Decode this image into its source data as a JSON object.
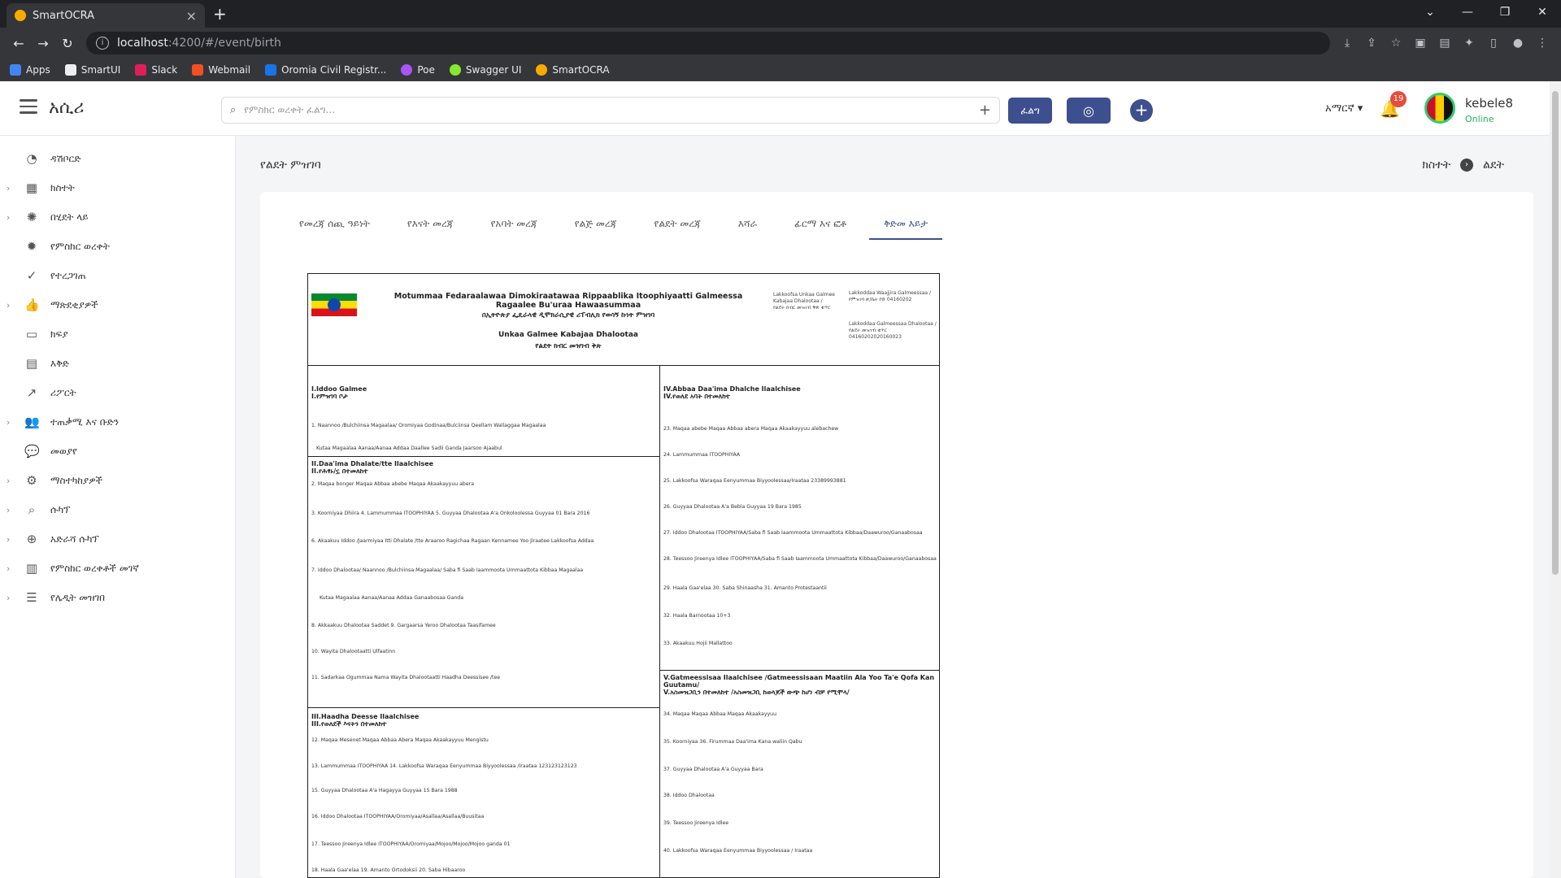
{
  "browser": {
    "tab_title": "SmartOCRA",
    "url_host": "localhost",
    "url_path": ":4200/#/event/birth",
    "bookmarks": [
      "Apps",
      "SmartUI",
      "Slack",
      "Webmail",
      "Oromia Civil Registr...",
      "Poe",
      "Swagger UI",
      "SmartOCRA"
    ]
  },
  "header": {
    "brand": "አሲሪ",
    "search_placeholder": "የምስክር ወረቀት ፈልግ...",
    "search_button": "ፈልግ",
    "language": "አማርኛ",
    "notification_count": "19",
    "user_name": "kebele8",
    "user_status": "Online"
  },
  "sidebar": {
    "items": [
      {
        "label": "ዳሽቦርድ",
        "icon": "dashboard-icon"
      },
      {
        "label": "ክስተት",
        "icon": "calendar-icon"
      },
      {
        "label": "በሂደት ላይ",
        "icon": "spinner-icon"
      },
      {
        "label": "የምስክር ወረቀት",
        "icon": "certificate-icon"
      },
      {
        "label": "የተረጋገጠ",
        "icon": "check-circle-icon"
      },
      {
        "label": "ማጽደቂያዎች",
        "icon": "thumbs-up-icon"
      },
      {
        "label": "ክፍያ",
        "icon": "credit-card-icon"
      },
      {
        "label": "እቅድ",
        "icon": "planner-icon"
      },
      {
        "label": "ሪፖርት",
        "icon": "chart-line-icon"
      },
      {
        "label": "ተጠቃሚ እና ቡድን",
        "icon": "users-icon"
      },
      {
        "label": "መወያየ",
        "icon": "chat-icon"
      },
      {
        "label": "ማስተካከያዎች",
        "icon": "gear-icon"
      },
      {
        "label": "ሱካፕ",
        "icon": "zoom-icon"
      },
      {
        "label": "አድራሻ ሱካፕ",
        "icon": "zoom-plus-icon"
      },
      {
        "label": "የምስክር ወረቀቶች መገኛ",
        "icon": "archive-icon"
      },
      {
        "label": "የሌዲት መዝገበ",
        "icon": "list-icon"
      }
    ]
  },
  "page": {
    "title": "የልደት ምዝገባ",
    "breadcrumb_1": "ክስተት",
    "breadcrumb_2": "ልደት",
    "tabs": [
      "የመረጃ ሰጪ ዓይነት",
      "የእናት መረጃ",
      "የአባት መረጃ",
      "የልጅ መረጃ",
      "የልደት መረጃ",
      "እሻራ",
      "ፊርማ እና ፎቶ",
      "ቅድመ እይታ"
    ]
  },
  "document": {
    "title_om": "Motummaa Fedaraalawaa Dimokiraatawaa Rippaablika Itoophiyaatti Galmeessa Ragaalee Bu'uraa Hawaasummaa",
    "title_am": "በኢትዮጵያ ፌዴራላዊ ዲሞክራሲያዊ ሪፐብሊክ የወሳኝ ኩነት ምዝገባ",
    "subtitle_om": "Unkaa Galmee Kabajaa Dhalootaa",
    "subtitle_am": "የልደት ክብር መዝገብ ቅጽ",
    "reg_left": "Lakkoofsa Unkaa Galmee Kabajaa Dhalootaa / የልደት ክብር መዝገብ ቅጽ ቁጥር",
    "reg_right_1": "Lakkoddaa Waajjira Galmeessaa / የምዝገባ ጽ/ቤት ኮድ 04160202",
    "reg_right_2": "Lakkoddaa Galmeessaa Dhalootaa / የልደት መዝገብ ቁጥር 04160202020160023",
    "sec1": "I.Iddoo Galmee\nI.የምዝገባ ቦታ",
    "sec1_l1": "1. Naannoo /Bulchiinsa Magaalaa/   Oromiyaa        Godinaa/Bulciinsa  Qeellam Wallaggaa        Magaalaa",
    "sec1_l2": "Kutaa Magaalaa              Aanaa/Aanaa Addaa   Daallee Sadii          Ganda  Jaarsoo Ajaabul",
    "sec2": "II.Daa'ima Dhalate/tte Ilaalchisee\nII.የሕፃኑ/ኗ በተመለከተ",
    "sec2_l1": "2. Maqaa  bonger             Maqaa Abbaa  abebe               Maqaa Akaakayyuu  abera",
    "sec2_l2": "3. Koorniyaa  Dhiira    4. Lammummaa  ITOOPHIYAA    5. Guyyaa Dhalootaa A'a Onkoloolessa Guyyaa 01   Bara 2016",
    "sec2_l3": "6. Akaakuu Iddoo /Jaarmiyaa Itti Dhalate /tte  Araaroo Ragichaa     Ragaan Kennamee Yoo Jiraatee Lakkoofsa Addaa",
    "sec2_l4": "7. Iddoo Dhalootaa/  Naannoo /Bulchiinsa Magaalaa/  Saba fi Saab Iaammoota Ummaattota Kibbaa     Magaalaa",
    "sec2_l5": "Kutaa Magaalaa            Aanaa/Aanaa Addaa  Ganaabosaa               Ganda",
    "sec2_l6": "8. Akkaakuu Dhalootaa  Saddet    9. Gargaarsa Yeroo Dhalootaa  Taasifamee",
    "sec2_l7": "10. Wayita Dhalootaatti Ulfaatinn",
    "sec2_l8": "11. Sadarkaa Ogummaa Nama Wayita Dhalootaatti Haadha Deessisee /tee",
    "sec3": "III.Haadha Deesse Ilaalchisee\nIII.የወለደች እናትን በተመለከተ",
    "sec3_l1": "12. Maqaa  Mesenet             Maqaa Abbaa  Abera                Maqaa Akaakayyuu  Mengistu",
    "sec3_l2": "13. Lammummaa  ITOOPHIYAA     14. Lakkoofsa Waraqaa Eenyummaa Biyyoolessaa /Iraataa  123123123123",
    "sec3_l3": "15. Guyyaa Dhalootaa A'a  Hagayya    Guyyaa  15      Bara  1988",
    "sec3_l4": "16. Iddoo Dhalootaa  ITOOPHIYAA/Oromiyaa/Asallaa/Asallaa/Buusitaa",
    "sec3_l5": "17. Teessoo Jireenya Idlee  ITOOPHIYAA/Oromiyaa/Mojoo/Mojoo/Mojoo ganda 01",
    "sec3_l6": "18. Haala Gaa'elaa            19. Amanto  Ortodoksii       20. Saba  Hibaaroo",
    "sec4": "IV.Abbaa Daa'ima Dhalche Ilaalchisee\nIV.የወለደ አባት በተመለከተ",
    "sec4_l1": "23. Maqaa  abebe           Maqaa Abbaa  abera           Maqaa Akaakayyuu  alebachew",
    "sec4_l2": "24. Lammummaa  ITOOPHIYAA",
    "sec4_l3": "25. Lakkoofsa Waraqaa Eenyummaa Biyyoolessaa/Iraataa  23389993881",
    "sec4_l4": "26. Guyyaa Dhalootaa A'a  Bebla        Guyyaa  19         Bara  1985",
    "sec4_l5": "27. Iddoo Dhalootaa  ITOOPHIYAA/Saba fi Saab Iaammoota Ummaattota Kibbaa/Daawuroo/Ganaabosaa",
    "sec4_l6": "28. Teessoo Jireenya Idlee  ITOOPHIYAA/Saba fi Saab Iaammoota Ummaattota Kibbaa/Daawuroo/Ganaabosaa",
    "sec4_l7": "29. Haala Gaa'elaa            30. Saba  Shinaasha      31. Amanto  Protestaantii",
    "sec4_l8": "32. Haala Barnootaa  10+3",
    "sec4_l9": "33. Akaakuu Hojii                          Mallattoo",
    "sec5": "V.Gatmeessisaa Ilaalchisee /Gatmeessisaan Maatiin Ala Yoo Ta'e Qofa Kan Guutamu/\nV.አስመዝጋቢን በተመለከተ /አስመዝጋቢ ከወላጆች ውጭ ከሆነ ብቻ የሚሞላ/",
    "sec5_l1": "34. Maqaa                  Maqaa Abbaa               Maqaa Akaakayyuu",
    "sec5_l2": "35. Koorniyaa        36. Firummaa Daa'ima Kana waliin Qabu",
    "sec5_l3": "37. Guyyaa Dhalootaa A'a            Guyyaa                  Bara",
    "sec5_l4": "38. Iddoo Dhalootaa",
    "sec5_l5": "39. Teessoo Jireenya Idlee",
    "sec5_l6": "40. Lakkoofsa Waraqaa Eenyummaa Biyyoolessaa / Iraataa"
  }
}
